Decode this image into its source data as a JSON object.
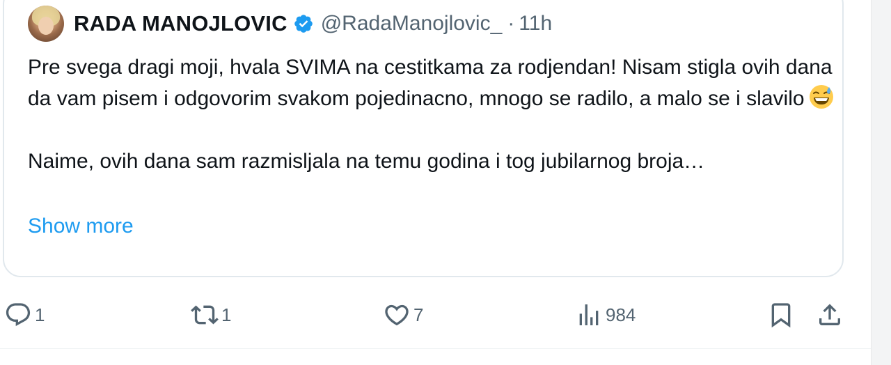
{
  "tweet": {
    "author_name": "RADA MANOJLOVIC",
    "handle": "@RadaManojlovic_",
    "separator": "·",
    "time": "11h",
    "paragraph1": "Pre svega dragi moji, hvala SVIMA na cestitkama za rodjendan! Nisam stigla ovih dana da vam pisem i odgovorim svakom pojedinacno, mnogo se radilo, a malo se i slavilo",
    "paragraph2": "Naime, ovih dana sam razmisljala na temu godina i tog jubilarnog broja…",
    "show_more": "Show more",
    "emoji": "grinning-face-with-sweat-emoji"
  },
  "actions": {
    "reply_count": "1",
    "repost_count": "1",
    "like_count": "7",
    "views_count": "984"
  },
  "icons": {
    "verified": "verified-badge-icon",
    "reply": "reply-icon",
    "repost": "repost-icon",
    "like": "heart-icon",
    "views": "views-icon",
    "bookmark": "bookmark-icon",
    "share": "share-icon"
  },
  "colors": {
    "text": "#0f1419",
    "secondary": "#536471",
    "link": "#1d9bf0",
    "border": "#e1e8ed"
  }
}
